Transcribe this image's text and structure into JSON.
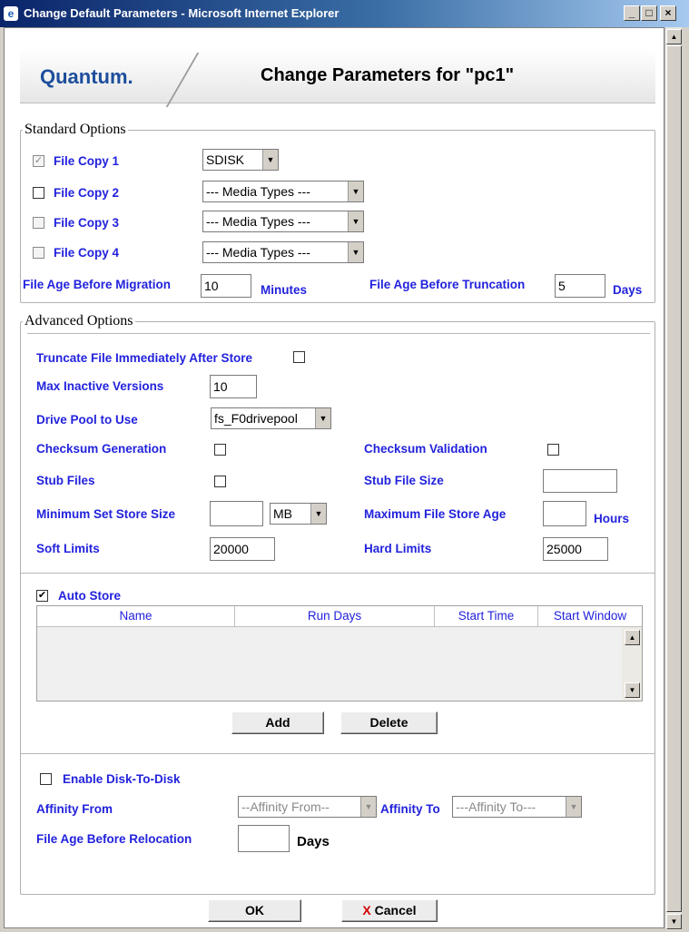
{
  "window": {
    "title": "Change Default Parameters - Microsoft Internet Explorer",
    "minimize": "_",
    "maximize": "□",
    "close": "×"
  },
  "header": {
    "logo": "Quantum.",
    "title": "Change Parameters for \"pc1\""
  },
  "standard": {
    "legend": "Standard Options",
    "copies": [
      {
        "label": "File Copy 1",
        "checked": true,
        "disabled": true,
        "media": "SDISK"
      },
      {
        "label": "File Copy 2",
        "checked": false,
        "disabled": false,
        "media": "--- Media Types ---"
      },
      {
        "label": "File Copy 3",
        "checked": false,
        "disabled": true,
        "media": "--- Media Types ---"
      },
      {
        "label": "File Copy 4",
        "checked": false,
        "disabled": true,
        "media": "--- Media Types ---"
      }
    ],
    "migration_label": "File Age Before Migration",
    "migration_value": "10",
    "migration_unit": "Minutes",
    "truncation_label": "File Age Before Truncation",
    "truncation_value": "5",
    "truncation_unit": "Days"
  },
  "advanced": {
    "legend": "Advanced Options",
    "truncate_label": "Truncate File Immediately After Store",
    "max_inactive_label": "Max Inactive Versions",
    "max_inactive_value": "10",
    "drive_pool_label": "Drive Pool to Use",
    "drive_pool_value": "fs_F0drivepool",
    "checksum_gen_label": "Checksum Generation",
    "checksum_val_label": "Checksum Validation",
    "stub_files_label": "Stub Files",
    "stub_size_label": "Stub File Size",
    "stub_size_value": "",
    "min_set_label": "Minimum Set Store Size",
    "min_set_value": "",
    "min_set_unit": "MB",
    "max_age_label": "Maximum File Store Age",
    "max_age_value": "",
    "max_age_unit": "Hours",
    "soft_limits_label": "Soft Limits",
    "soft_limits_value": "20000",
    "hard_limits_label": "Hard Limits",
    "hard_limits_value": "25000"
  },
  "autostore": {
    "check_mark": "✔",
    "label": "Auto Store",
    "columns": [
      "Name",
      "Run Days",
      "Start Time",
      "Start Window"
    ],
    "rows": [],
    "add_label": "Add",
    "delete_label": "Delete"
  },
  "disk": {
    "enable_label": "Enable Disk-To-Disk",
    "affinity_from_label": "Affinity From",
    "affinity_from_value": "--Affinity From--",
    "affinity_to_label": "Affinity To",
    "affinity_to_value": "---Affinity To---",
    "relocation_label": "File Age Before Relocation",
    "relocation_value": "",
    "relocation_unit": "Days"
  },
  "footer": {
    "ok_label": "OK",
    "cancel_icon": "X",
    "cancel_label": "Cancel"
  },
  "colors": {
    "label_blue": "#2222dd",
    "titlebar": "#0a246a",
    "brand": "#1d4e9c",
    "cancel_x": "#d40000"
  }
}
